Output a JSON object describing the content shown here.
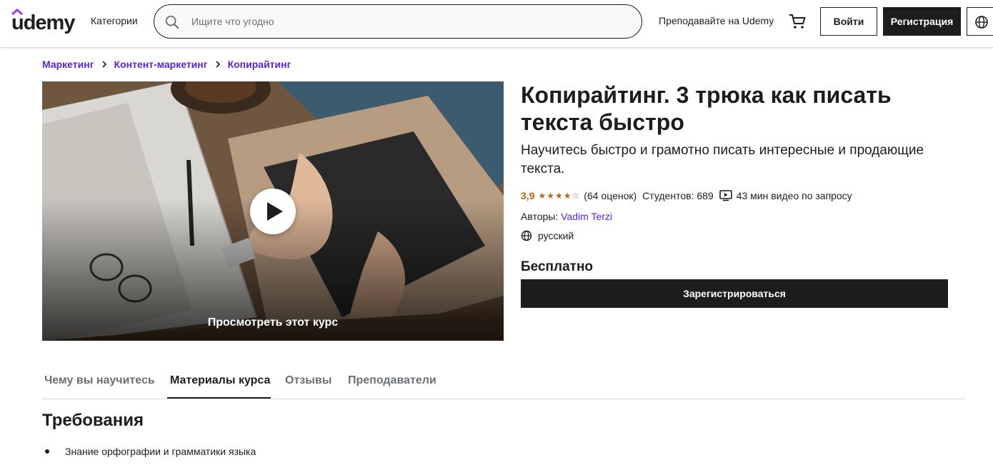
{
  "header": {
    "logo": "udemy",
    "categories": "Категории",
    "search_placeholder": "Ищите что угодно",
    "teach": "Преподавайте на Udemy",
    "login": "Войти",
    "signup": "Регистрация"
  },
  "breadcrumb": [
    "Маркетинг",
    "Контент-маркетинг",
    "Копирайтинг"
  ],
  "preview": {
    "label": "Просмотреть этот курс"
  },
  "course": {
    "title": "Копирайтинг. 3 трюка как писать текста быстро",
    "subtitle": "Научитесь быстро и грамотно писать интересные и продающие текста.",
    "rating": "3,9",
    "stars_filled": 4,
    "ratings_count": "(64 оценок)",
    "students": "Студентов: 689",
    "video": "43 мин видео по запросу",
    "authors_label": "Авторы:",
    "author": "Vadim Terzi",
    "language": "русский",
    "price": "Бесплатно",
    "enroll": "Зарегистрироваться"
  },
  "tabs": [
    {
      "label": "Чему вы научитесь",
      "active": false
    },
    {
      "label": "Материалы курса",
      "active": true
    },
    {
      "label": "Отзывы",
      "active": false
    },
    {
      "label": "Преподаватели",
      "active": false
    }
  ],
  "requirements": {
    "title": "Требования",
    "items": [
      "Знание орфографии и грамматики языка"
    ]
  },
  "colors": {
    "accent": "#5624d0",
    "rating": "#b4690e",
    "dark": "#1c1d1f"
  }
}
